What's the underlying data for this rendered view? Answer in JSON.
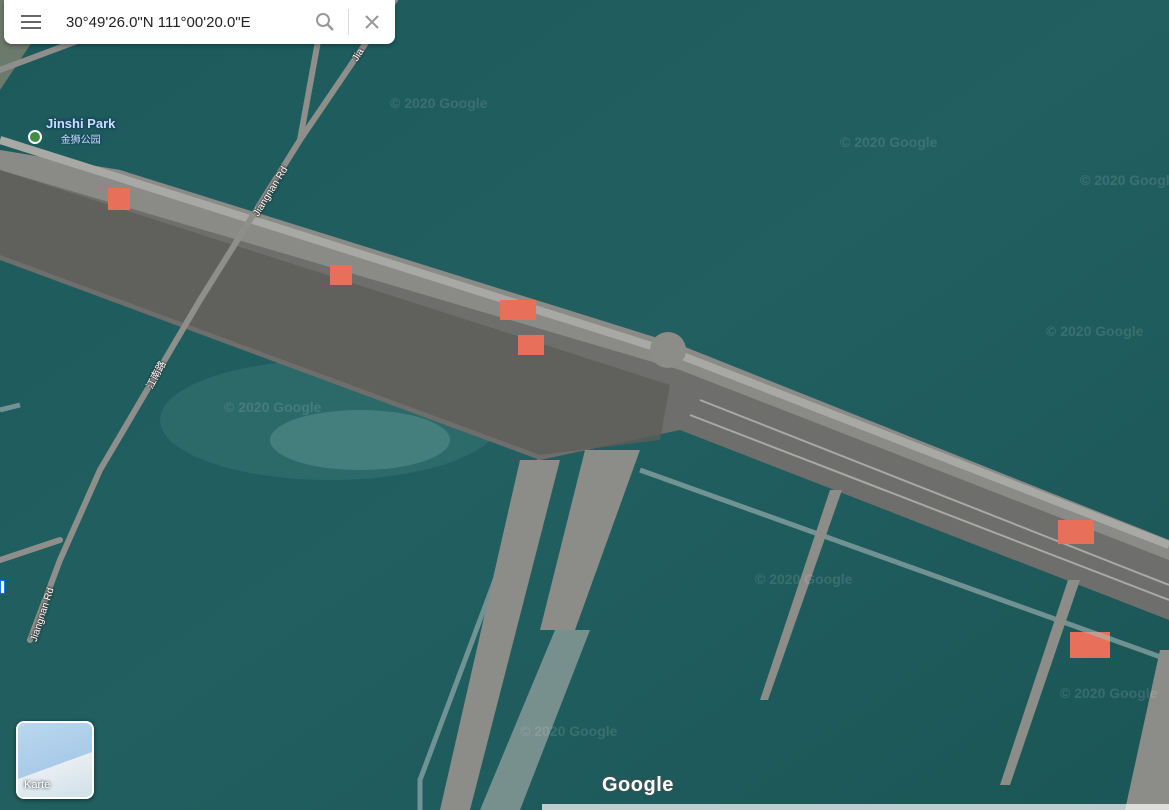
{
  "search": {
    "value": "30°49'26.0\"N 111°00'20.0\"E",
    "menu_icon": "menu-icon",
    "search_icon": "search-icon",
    "close_icon": "close-icon"
  },
  "poi": {
    "name": "Jinshi Park",
    "subname": "金狮公园"
  },
  "roads": [
    {
      "label": "Jiangnan Rd"
    },
    {
      "label": "Jiangnan Rd"
    },
    {
      "label": "江南路"
    },
    {
      "label": "Jia"
    }
  ],
  "watermark": "© 2020 Google",
  "layer_toggle": {
    "label": "Karte"
  },
  "brand": "Google",
  "colors": {
    "water": "#1f5e5e",
    "dam": "#7a7a78",
    "crane": "#e8705a",
    "road": "#9a9a96"
  }
}
